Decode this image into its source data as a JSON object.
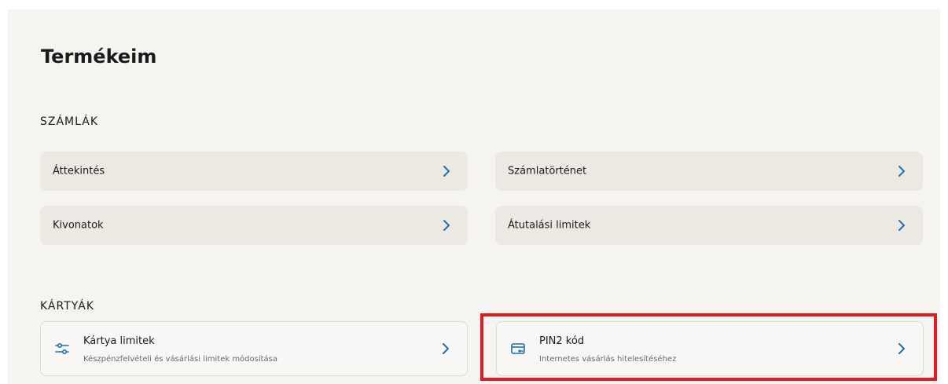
{
  "page": {
    "title": "Termékeim"
  },
  "accounts": {
    "heading": "SZÁMLÁK",
    "items": [
      {
        "label": "Áttekintés"
      },
      {
        "label": "Számlatörténet"
      },
      {
        "label": "Kivonatok"
      },
      {
        "label": "Átutalási limitek"
      }
    ]
  },
  "cards": {
    "heading": "KÁRTYÁK",
    "items": [
      {
        "title": "Kártya limitek",
        "subtitle": "Készpénzfelvételi és vásárlási limitek módosítása",
        "icon": "sliders-icon"
      },
      {
        "title": "PIN2 kód",
        "subtitle": "Internetes vásárlás hitelesítéséhez",
        "icon": "card-key-icon"
      }
    ]
  },
  "colors": {
    "accent": "#1f6fb2",
    "highlight": "#e01b24",
    "panel_background": "#f5f4f1",
    "row_background": "#ece9e3"
  }
}
